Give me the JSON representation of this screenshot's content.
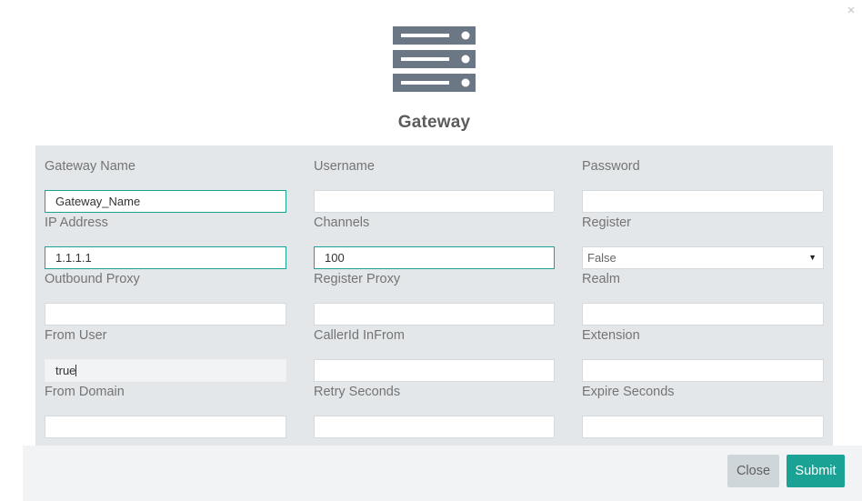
{
  "dialog": {
    "title": "Gateway",
    "close_glyph": "×",
    "icon": "server-icon"
  },
  "fields": {
    "gateway_name": {
      "label": "Gateway Name",
      "value": "Gateway_Name"
    },
    "username": {
      "label": "Username",
      "value": ""
    },
    "password": {
      "label": "Password",
      "value": ""
    },
    "ip_address": {
      "label": "IP Address",
      "value": "1.1.1.1"
    },
    "channels": {
      "label": "Channels",
      "value": "100"
    },
    "register": {
      "label": "Register",
      "value": "False",
      "options": [
        "False"
      ]
    },
    "outbound_proxy": {
      "label": "Outbound Proxy",
      "value": ""
    },
    "register_proxy": {
      "label": "Register Proxy",
      "value": ""
    },
    "realm": {
      "label": "Realm",
      "value": ""
    },
    "from_user": {
      "label": "From User",
      "value": "true"
    },
    "callerid_infrom": {
      "label": "CallerId InFrom",
      "value": ""
    },
    "extension": {
      "label": "Extension",
      "value": ""
    },
    "from_domain": {
      "label": "From Domain",
      "value": ""
    },
    "retry_seconds": {
      "label": "Retry Seconds",
      "value": ""
    },
    "expire_seconds": {
      "label": "Expire Seconds",
      "value": ""
    }
  },
  "footer": {
    "close_label": "Close",
    "submit_label": "Submit"
  },
  "colors": {
    "accent": "#1aa394",
    "icon": "#6b7785",
    "panel": "#e4e7e9"
  }
}
